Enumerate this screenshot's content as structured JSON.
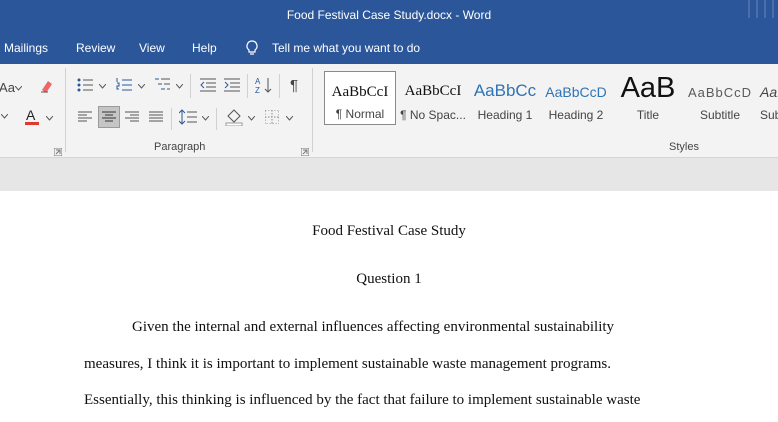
{
  "window": {
    "title": "Food Festival Case Study.docx  -  Word"
  },
  "menu": {
    "tabs": [
      "Mailings",
      "Review",
      "View",
      "Help"
    ],
    "tell_me": "Tell me what you want to do"
  },
  "ribbon": {
    "font_partial_label": "Aa",
    "paragraph_group_label": "Paragraph",
    "styles_group_label": "Styles",
    "styles": [
      {
        "sample": "AaBbCcI",
        "name": "¶ Normal"
      },
      {
        "sample": "AaBbCcI",
        "name": "¶ No Spac..."
      },
      {
        "sample": "AaBbCc",
        "name": "Heading 1"
      },
      {
        "sample": "AaBbCcD",
        "name": "Heading 2"
      },
      {
        "sample": "AaB",
        "name": "Title"
      },
      {
        "sample": "AaBbCcD",
        "name": "Subtitle"
      },
      {
        "sample": "AaI",
        "name": "Sub"
      }
    ],
    "colors": {
      "ribbon_bg": "#f3f3f3",
      "title_bar": "#2b579a",
      "font_color_red": "#e03a2f"
    }
  },
  "document": {
    "title": "Food Festival Case Study",
    "heading": "Question 1",
    "lines": [
      "Given the internal and external influences affecting environmental sustainability",
      "measures, I think it is important to implement sustainable waste management programs.",
      "Essentially, this thinking is influenced by the fact that failure to implement sustainable waste"
    ]
  }
}
